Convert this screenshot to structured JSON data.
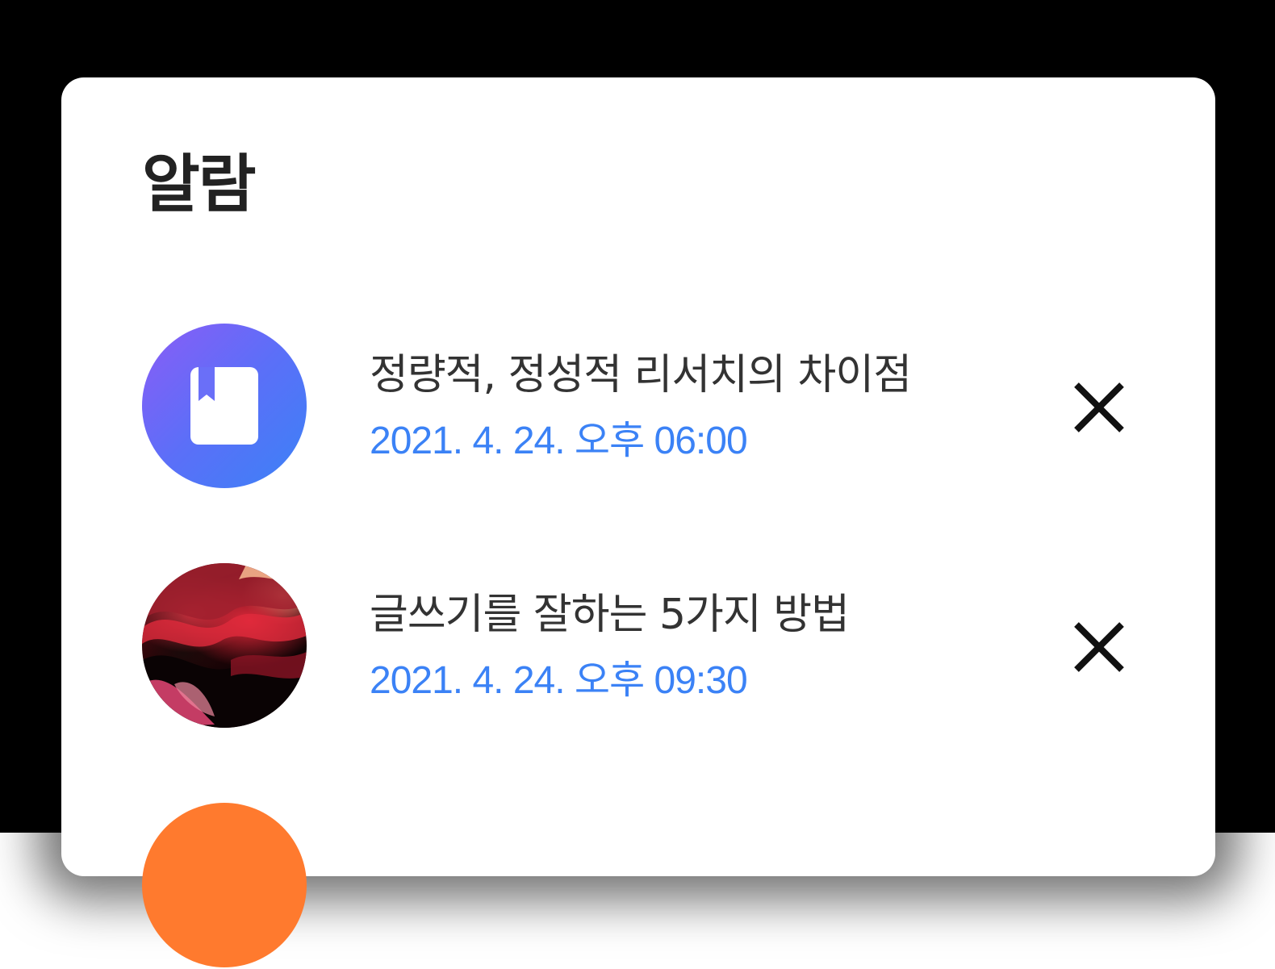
{
  "header": {
    "title": "알람"
  },
  "notifications": [
    {
      "title": "정량적, 정성적 리서치의 차이점",
      "time": "2021. 4. 24. 오후 06:00",
      "avatar_icon": "book-bookmark-icon"
    },
    {
      "title": "글쓰기를 잘하는 5가지 방법",
      "time": "2021. 4. 24. 오후 09:30",
      "avatar_icon": "abstract-wave-image"
    },
    {
      "title": "",
      "time": "",
      "avatar_icon": "orange-avatar"
    }
  ],
  "close_icon": "close-icon",
  "colors": {
    "accent": "#3b82f6",
    "title": "#222222",
    "item_text": "#333333",
    "gradient_start": "#8b5cf6",
    "gradient_end": "#3b82f6",
    "orange": "#ff7a2e"
  }
}
